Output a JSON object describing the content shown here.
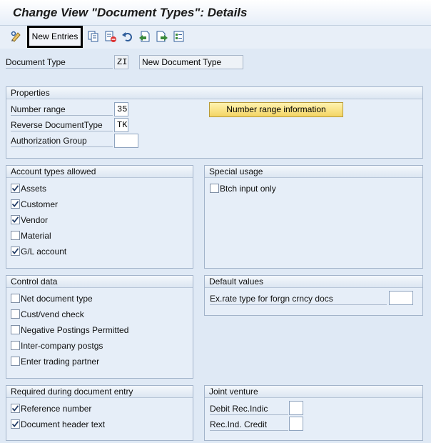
{
  "title": "Change View \"Document Types\": Details",
  "toolbar": {
    "new_entries": "New Entries",
    "icons": [
      "display-change-icon",
      "copy-icon",
      "delete-icon",
      "undo-icon",
      "previous-entry-icon",
      "next-entry-icon",
      "select-all-icon"
    ]
  },
  "header": {
    "doc_type_label": "Document Type",
    "doc_type_value": "ZI",
    "doc_type_desc": "New Document Type"
  },
  "properties": {
    "title": "Properties",
    "number_range_label": "Number range",
    "number_range_value": "35",
    "reverse_label": "Reverse DocumentType",
    "reverse_value": "TK",
    "auth_label": "Authorization Group",
    "auth_value": "",
    "nr_info_button": "Number range information"
  },
  "account_types": {
    "title": "Account types allowed",
    "items": [
      {
        "label": "Assets",
        "checked": true
      },
      {
        "label": "Customer",
        "checked": true
      },
      {
        "label": "Vendor",
        "checked": true
      },
      {
        "label": "Material",
        "checked": false
      },
      {
        "label": "G/L account",
        "checked": true
      }
    ]
  },
  "special_usage": {
    "title": "Special usage",
    "items": [
      {
        "label": "Btch input only",
        "checked": false
      }
    ]
  },
  "control_data": {
    "title": "Control data",
    "items": [
      {
        "label": "Net document type",
        "checked": false
      },
      {
        "label": "Cust/vend check",
        "checked": false
      },
      {
        "label": "Negative Postings Permitted",
        "checked": false
      },
      {
        "label": "Inter-company postgs",
        "checked": false
      },
      {
        "label": "Enter trading partner",
        "checked": false
      }
    ]
  },
  "default_values": {
    "title": "Default values",
    "ex_rate_label": "Ex.rate type for forgn crncy docs",
    "ex_rate_value": ""
  },
  "required_entry": {
    "title": "Required during document entry",
    "items": [
      {
        "label": "Reference number",
        "checked": true
      },
      {
        "label": "Document header text",
        "checked": true
      }
    ]
  },
  "joint_venture": {
    "title": "Joint venture",
    "debit_label": "Debit Rec.Indic",
    "debit_value": "",
    "credit_label": "Rec.Ind. Credit",
    "credit_value": ""
  },
  "colors": {
    "background": "#dfe9f5",
    "button_yellow": "#f4d564",
    "group_border": "#a3b4ca"
  }
}
